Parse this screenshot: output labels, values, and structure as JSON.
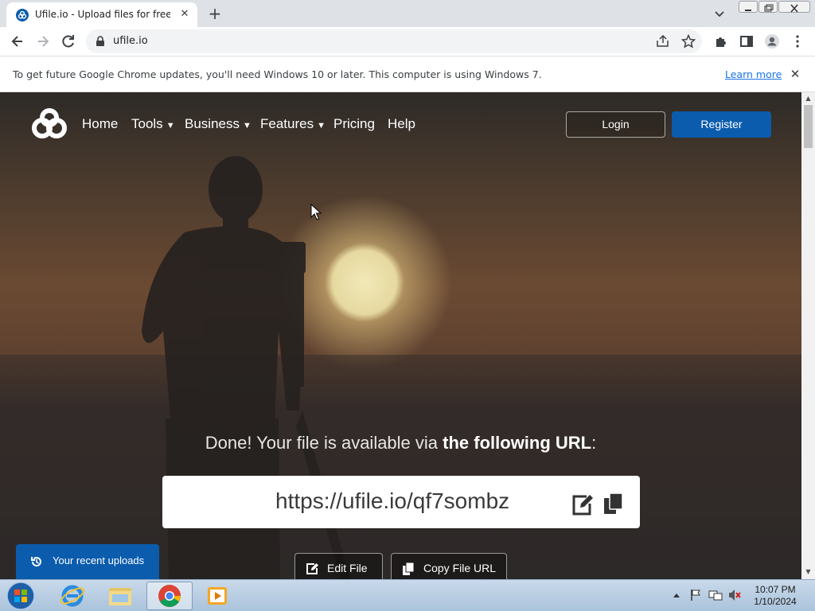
{
  "browser": {
    "tab_title": "Ufile.io - Upload files for free & s",
    "url": "ufile.io",
    "infobar_text": "To get future Google Chrome updates, you'll need Windows 10 or later. This computer is using Windows 7.",
    "infobar_link": "Learn more"
  },
  "nav": {
    "items": [
      {
        "label": "Home"
      },
      {
        "label": "Tools"
      },
      {
        "label": "Business"
      },
      {
        "label": "Features"
      },
      {
        "label": "Pricing"
      },
      {
        "label": "Help"
      }
    ],
    "login": "Login",
    "register": "Register"
  },
  "main": {
    "done_prefix": "Done! Your file is available via ",
    "done_bold": "the following URL",
    "done_suffix": ":",
    "file_url": "https://ufile.io/qf7sombz",
    "edit_file": "Edit File",
    "copy_url": "Copy File URL",
    "recent_uploads": "Your recent uploads"
  },
  "taskbar": {
    "time": "10:07 PM",
    "date": "1/10/2024"
  },
  "colors": {
    "brand_blue": "#0b5cad",
    "link_blue": "#1a73e8"
  },
  "icons": [
    "ufile-logo-icon",
    "back-icon",
    "forward-icon",
    "reload-icon",
    "lock-icon",
    "share-icon",
    "star-icon",
    "extensions-icon",
    "sidepanel-icon",
    "profile-icon",
    "menu-icon",
    "edit-icon",
    "copy-icon",
    "history-icon"
  ]
}
